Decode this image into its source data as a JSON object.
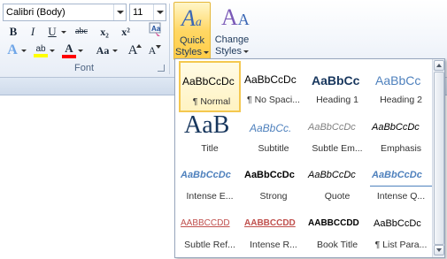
{
  "font_group": {
    "font_name": "Calibri (Body)",
    "font_size": "11",
    "label": "Font",
    "buttons": {
      "grow": "A",
      "shrink": "A",
      "bold": "B",
      "italic": "I",
      "underline": "U",
      "strike": "abc",
      "subscript": "x₂",
      "superscript": "x²",
      "text_effects": "A",
      "highlight": "ab",
      "font_color": "A",
      "change_case": "Aa"
    }
  },
  "styles_group": {
    "quick_styles_line1": "Quick",
    "quick_styles_line2": "Styles",
    "change_styles_line1": "Change",
    "change_styles_line2": "Styles"
  },
  "gallery": {
    "styles": [
      {
        "sample": "AaBbCcDc",
        "name": "¶ Normal"
      },
      {
        "sample": "AaBbCcDc",
        "name": "¶ No Spaci..."
      },
      {
        "sample": "AaBbCc",
        "name": "Heading 1"
      },
      {
        "sample": "AaBbCc",
        "name": "Heading 2"
      },
      {
        "sample": "AaB",
        "name": "Title"
      },
      {
        "sample": "AaBbCc.",
        "name": "Subtitle"
      },
      {
        "sample": "AaBbCcDc",
        "name": "Subtle Em..."
      },
      {
        "sample": "AaBbCcDc",
        "name": "Emphasis"
      },
      {
        "sample": "AaBbCcDc",
        "name": "Intense E..."
      },
      {
        "sample": "AaBbCcDc",
        "name": "Strong"
      },
      {
        "sample": "AaBbCcDc",
        "name": "Quote"
      },
      {
        "sample": "AaBbCcDc",
        "name": "Intense Q..."
      },
      {
        "sample": "AABBCCDD",
        "name": "Subtle Ref..."
      },
      {
        "sample": "AABBCCDD",
        "name": "Intense R..."
      },
      {
        "sample": "AABBCCDD",
        "name": "Book Title"
      },
      {
        "sample": "AaBbCcDc",
        "name": "¶ List Para..."
      }
    ],
    "selected_index": 0
  },
  "colors": {
    "heading_blue": "#17365d",
    "accent_blue": "#4f81bd",
    "subtle_red": "#c0504d",
    "selected_gold": "#f4c84f",
    "highlight_yellow": "#ffff00",
    "font_color_red": "#ff0000"
  },
  "icons": [
    "text-effects-icon",
    "highlight-icon",
    "font-color-icon",
    "clear-formatting-icon",
    "quick-styles-icon",
    "change-styles-icon",
    "scroll-up-icon",
    "scroll-down-icon",
    "dialog-launcher-icon"
  ]
}
